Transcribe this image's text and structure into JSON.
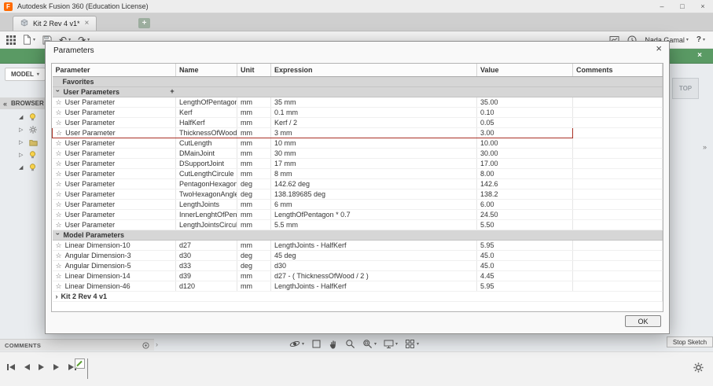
{
  "titlebar": {
    "app_title": "Autodesk Fusion 360 (Education License)"
  },
  "icons": {
    "minimize": "–",
    "maximize": "□",
    "close": "×",
    "plus": "+",
    "caret_down": "▾",
    "chevron_right": "›",
    "star": "☆",
    "undo": "↶",
    "redo": "↷",
    "collapse": "«",
    "expand_right": "»",
    "tree_open": "◢",
    "tree_closed": "▷",
    "help": "?"
  },
  "tab_bar": {
    "active_tab": "Kit 2 Rev 4 v1*"
  },
  "toolbar": {
    "user_name": "Nada Gamal"
  },
  "workspace": {
    "mode_label": "MODEL"
  },
  "browser": {
    "label": "BROWSER"
  },
  "viewcube": {
    "top_label": "TOP"
  },
  "comments_panel": {
    "label": "COMMENTS"
  },
  "sketch": {
    "stop_button": "Stop Sketch"
  },
  "dialog": {
    "title": "Parameters",
    "ok_label": "OK",
    "columns": [
      "Parameter",
      "Name",
      "Unit",
      "Expression",
      "Value",
      "Comments"
    ],
    "rows": [
      {
        "type": "section",
        "label": "Favorites"
      },
      {
        "type": "group",
        "label": "User Parameters",
        "add_button": true
      },
      {
        "type": "param",
        "param": "User Parameter",
        "name": "LengthOfPentagon",
        "unit": "mm",
        "expression": "35 mm",
        "value": "35.00",
        "comment": ""
      },
      {
        "type": "param",
        "param": "User Parameter",
        "name": "Kerf",
        "unit": "mm",
        "expression": "0.1 mm",
        "value": "0.10",
        "comment": ""
      },
      {
        "type": "param",
        "param": "User Parameter",
        "name": "HalfKerf",
        "unit": "mm",
        "expression": "Kerf / 2",
        "value": "0.05",
        "comment": ""
      },
      {
        "type": "param",
        "param": "User Parameter",
        "name": "ThicknessOfWood",
        "unit": "mm",
        "expression": "3 mm",
        "value": "3.00",
        "comment": "",
        "highlight": true
      },
      {
        "type": "param",
        "param": "User Parameter",
        "name": "CutLength",
        "unit": "mm",
        "expression": "10 mm",
        "value": "10.00",
        "comment": ""
      },
      {
        "type": "param",
        "param": "User Parameter",
        "name": "DMainJoint",
        "unit": "mm",
        "expression": "30 mm",
        "value": "30.00",
        "comment": ""
      },
      {
        "type": "param",
        "param": "User Parameter",
        "name": "DSupportJoint",
        "unit": "mm",
        "expression": "17 mm",
        "value": "17.00",
        "comment": ""
      },
      {
        "type": "param",
        "param": "User Parameter",
        "name": "CutLengthCircule",
        "unit": "mm",
        "expression": "8 mm",
        "value": "8.00",
        "comment": ""
      },
      {
        "type": "param",
        "param": "User Parameter",
        "name": "PentagonHexagon...",
        "unit": "deg",
        "expression": "142.62 deg",
        "value": "142.6",
        "comment": ""
      },
      {
        "type": "param",
        "param": "User Parameter",
        "name": "TwoHexagonAngle",
        "unit": "deg",
        "expression": "138.189685 deg",
        "value": "138.2",
        "comment": ""
      },
      {
        "type": "param",
        "param": "User Parameter",
        "name": "LengthJoints",
        "unit": "mm",
        "expression": "6 mm",
        "value": "6.00",
        "comment": ""
      },
      {
        "type": "param",
        "param": "User Parameter",
        "name": "InnerLenghtOfPent...",
        "unit": "mm",
        "expression": "LengthOfPentagon * 0.7",
        "value": "24.50",
        "comment": ""
      },
      {
        "type": "param",
        "param": "User Parameter",
        "name": "LengthJointsCircule",
        "unit": "mm",
        "expression": "5.5 mm",
        "value": "5.50",
        "comment": ""
      },
      {
        "type": "group",
        "label": "Model Parameters"
      },
      {
        "type": "param",
        "param": "Linear Dimension-10",
        "name": "d27",
        "unit": "mm",
        "expression": "LengthJoints - HalfKerf",
        "value": "5.95",
        "comment": ""
      },
      {
        "type": "param",
        "param": "Angular Dimension-3",
        "name": "d30",
        "unit": "deg",
        "expression": "45 deg",
        "value": "45.0",
        "comment": ""
      },
      {
        "type": "param",
        "param": "Angular Dimension-5",
        "name": "d33",
        "unit": "deg",
        "expression": "d30",
        "value": "45.0",
        "comment": ""
      },
      {
        "type": "param",
        "param": "Linear Dimension-14",
        "name": "d39",
        "unit": "mm",
        "expression": "d27 - ( ThicknessOfWood / 2 )",
        "value": "4.45",
        "comment": ""
      },
      {
        "type": "param",
        "param": "Linear Dimension-46",
        "name": "d120",
        "unit": "mm",
        "expression": "LengthJoints - HalfKerf",
        "value": "5.95",
        "comment": ""
      },
      {
        "type": "collapsed",
        "label": "Kit 2 Rev 4 v1"
      }
    ]
  }
}
